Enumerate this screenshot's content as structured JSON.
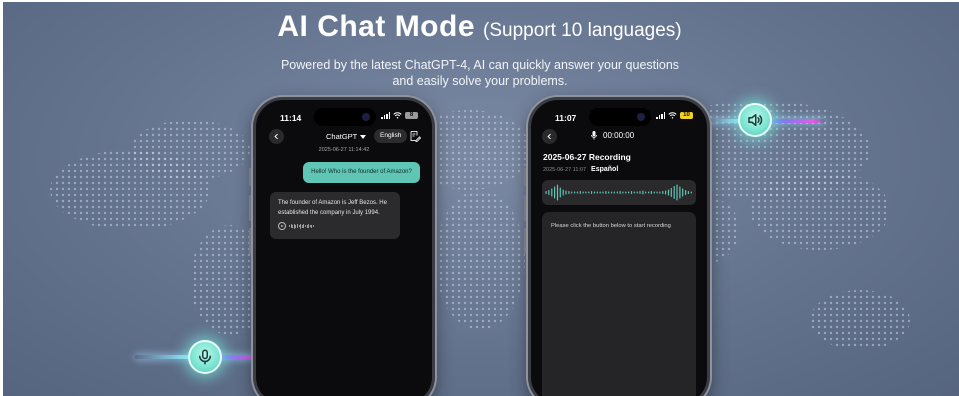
{
  "banner": {
    "title": "AI Chat Mode",
    "title_suffix": "(Support 10 languages)",
    "subtitle_line1": "Powered by the latest ChatGPT-4, AI can quickly answer your questions",
    "subtitle_line2": "and easily solve your problems."
  },
  "chat_phone": {
    "time": "11:14",
    "battery": "8",
    "model_selector": "ChatGPT",
    "language": "English",
    "date": "2025-06-27 11:14:42",
    "user_message": "Hello! Who is the founder of Amazon?",
    "ai_message": "The founder of Amazon is Jeff Bezos. He established the company in July 1994."
  },
  "record_phone": {
    "time": "11:07",
    "battery": "10",
    "timer": "00:00:00",
    "title": "2025-06-27 Recording",
    "meta_time": "2025-06-27 11:07",
    "meta_language": "Español",
    "hint": "Please click the button below to start recording"
  },
  "icons": {
    "microphone_button": "microphone-icon",
    "speaker_button": "speaker-icon"
  },
  "colors": {
    "accent_teal": "#5fc5b5",
    "background": "#64738e",
    "phone_screen": "#0b0b0d",
    "battery_yellow": "#f2d21c",
    "glow_pink": "#e25ce8"
  }
}
